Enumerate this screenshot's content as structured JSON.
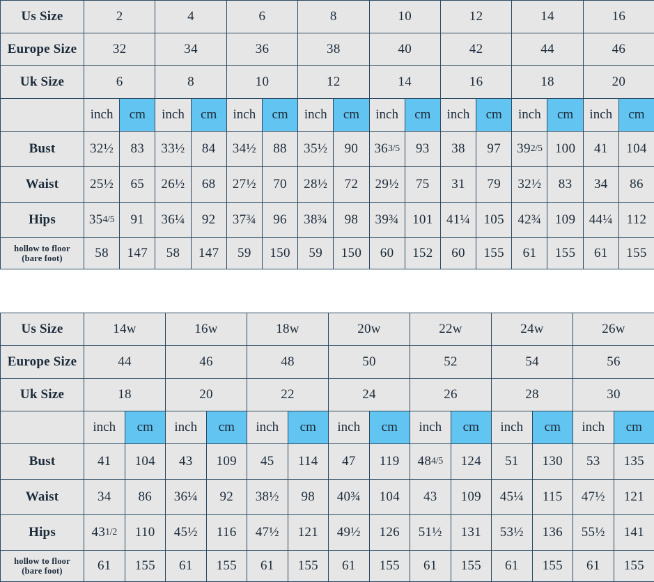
{
  "tables": [
    {
      "id": "standard-size-table",
      "row_labels": {
        "us": "Us Size",
        "europe": "Europe Size",
        "uk": "Uk Size",
        "unit_blank": "",
        "bust": "Bust",
        "waist": "Waist",
        "hips": "Hips",
        "hollow_line1": "hollow to floor",
        "hollow_line2": "(bare foot)"
      },
      "us_sizes": [
        "2",
        "4",
        "6",
        "8",
        "10",
        "12",
        "14",
        "16"
      ],
      "europe_sizes": [
        "32",
        "34",
        "36",
        "38",
        "40",
        "42",
        "44",
        "46"
      ],
      "uk_sizes": [
        "6",
        "8",
        "10",
        "12",
        "14",
        "16",
        "18",
        "20"
      ],
      "units": [
        "inch",
        "cm",
        "inch",
        "cm",
        "inch",
        "cm",
        "inch",
        "cm",
        "inch",
        "cm",
        "inch",
        "cm",
        "inch",
        "cm",
        "inch",
        "cm"
      ],
      "bust": [
        "32½",
        "83",
        "33½",
        "84",
        "34½",
        "88",
        "35½",
        "90",
        "36 3/5",
        "93",
        "38",
        "97",
        "39 2/5",
        "100",
        "41",
        "104"
      ],
      "waist": [
        "25½",
        "65",
        "26½",
        "68",
        "27½",
        "70",
        "28½",
        "72",
        "29½",
        "75",
        "31",
        "79",
        "32½",
        "83",
        "34",
        "86"
      ],
      "hips": [
        "35 4/5",
        "91",
        "36¼",
        "92",
        "37¾",
        "96",
        "38¾",
        "98",
        "39¾",
        "101",
        "41¼",
        "105",
        "42¾",
        "109",
        "44¼",
        "112"
      ],
      "hollow": [
        "58",
        "147",
        "58",
        "147",
        "59",
        "150",
        "59",
        "150",
        "60",
        "152",
        "60",
        "155",
        "61",
        "155",
        "61",
        "155"
      ]
    },
    {
      "id": "plus-size-table",
      "row_labels": {
        "us": "Us Size",
        "europe": "Europe Size",
        "uk": "Uk Size",
        "unit_blank": "",
        "bust": "Bust",
        "waist": "Waist",
        "hips": "Hips",
        "hollow_line1": "hollow to floor",
        "hollow_line2": "(bare foot)"
      },
      "us_sizes": [
        "14w",
        "16w",
        "18w",
        "20w",
        "22w",
        "24w",
        "26w"
      ],
      "europe_sizes": [
        "44",
        "46",
        "48",
        "50",
        "52",
        "54",
        "56"
      ],
      "uk_sizes": [
        "18",
        "20",
        "22",
        "24",
        "26",
        "28",
        "30"
      ],
      "units": [
        "inch",
        "cm",
        "inch",
        "cm",
        "inch",
        "cm",
        "inch",
        "cm",
        "inch",
        "cm",
        "inch",
        "cm",
        "inch",
        "cm"
      ],
      "bust": [
        "41",
        "104",
        "43",
        "109",
        "45",
        "114",
        "47",
        "119",
        "48 4/5",
        "124",
        "51",
        "130",
        "53",
        "135"
      ],
      "waist": [
        "34",
        "86",
        "36¼",
        "92",
        "38½",
        "98",
        "40¾",
        "104",
        "43",
        "109",
        "45¼",
        "115",
        "47½",
        "121"
      ],
      "hips": [
        "43 1/2",
        "110",
        "45½",
        "116",
        "47½",
        "121",
        "49½",
        "126",
        "51½",
        "131",
        "53½",
        "136",
        "55½",
        "141"
      ],
      "hollow": [
        "61",
        "155",
        "61",
        "155",
        "61",
        "155",
        "61",
        "155",
        "61",
        "155",
        "61",
        "155",
        "61",
        "155"
      ]
    }
  ],
  "colors": {
    "accent_blue": "#62c4f0",
    "cell_gray": "#e6e6e6",
    "border": "#2b4a63",
    "text": "#1c2b3a"
  }
}
